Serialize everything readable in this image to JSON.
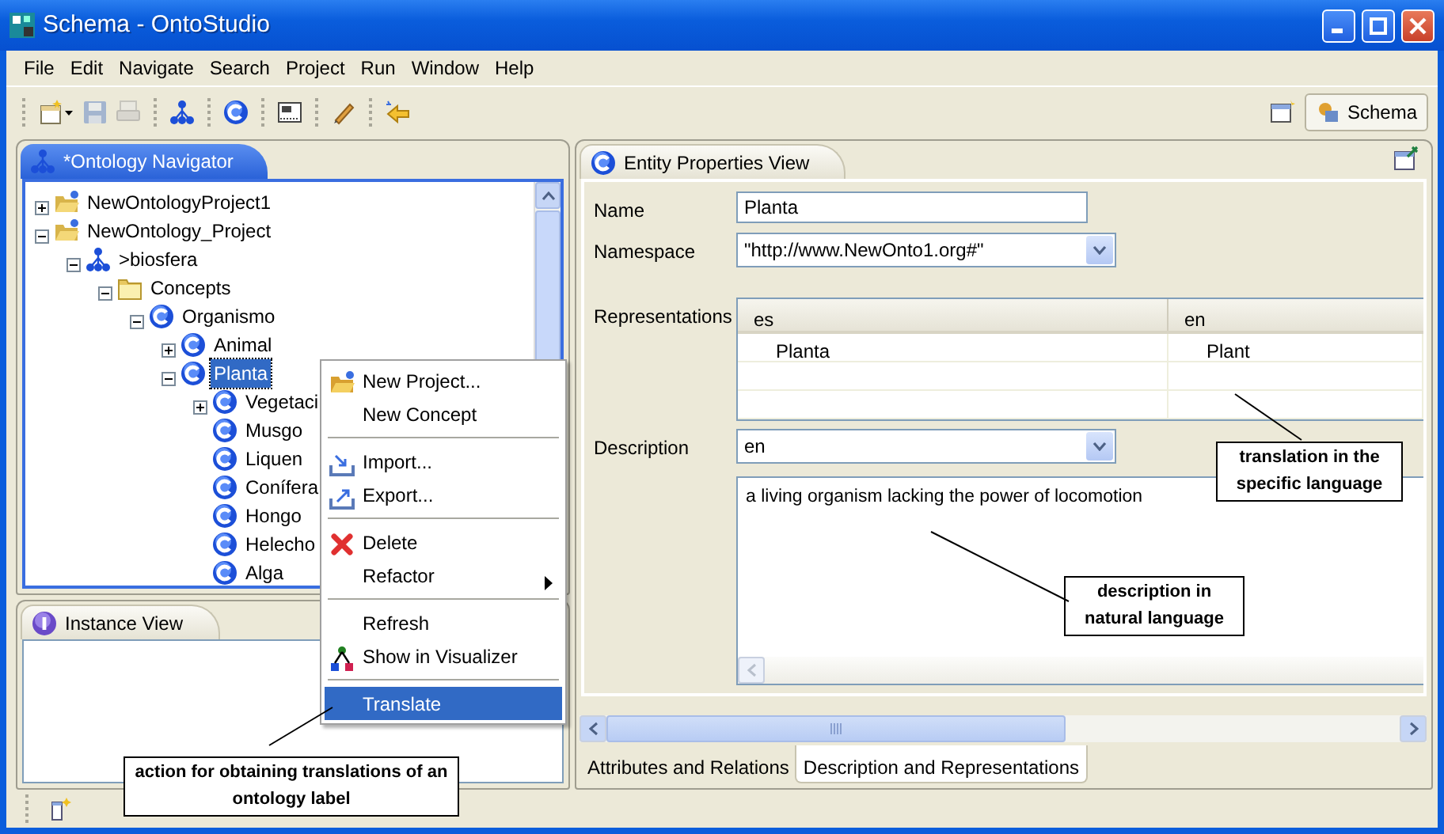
{
  "window": {
    "title": "Schema - OntoStudio"
  },
  "menu": [
    "File",
    "Edit",
    "Navigate",
    "Search",
    "Project",
    "Run",
    "Window",
    "Help"
  ],
  "toolbar": [
    {
      "kind": "new",
      "disabled": false
    },
    {
      "kind": "save",
      "disabled": true
    },
    {
      "kind": "print",
      "disabled": true
    },
    {
      "kind": "separator"
    },
    {
      "kind": "ontology",
      "disabled": false
    },
    {
      "kind": "separator"
    },
    {
      "kind": "concept",
      "disabled": false
    },
    {
      "kind": "separator"
    },
    {
      "kind": "document",
      "disabled": false
    },
    {
      "kind": "separator"
    },
    {
      "kind": "pen",
      "disabled": false
    },
    {
      "kind": "separator"
    },
    {
      "kind": "back",
      "disabled": false
    }
  ],
  "perspective": {
    "label": "Schema"
  },
  "navigator": {
    "title": "*Ontology Navigator",
    "active": true,
    "tree": [
      {
        "label": "NewOntologyProject1",
        "kind": "project",
        "expanded": false,
        "selected": false
      },
      {
        "label": "NewOntology_Project",
        "kind": "project",
        "expanded": true,
        "selected": false,
        "children": [
          {
            "label": ">biosfera",
            "kind": "ontology",
            "expanded": true,
            "selected": false,
            "children": [
              {
                "label": "Concepts",
                "kind": "folder",
                "expanded": true,
                "selected": false,
                "children": [
                  {
                    "label": "Organismo",
                    "kind": "concept",
                    "expanded": true,
                    "selected": false,
                    "children": [
                      {
                        "label": "Animal",
                        "kind": "concept",
                        "expanded": false,
                        "selected": false
                      },
                      {
                        "label": "Planta",
                        "kind": "concept",
                        "expanded": true,
                        "selected": true,
                        "children": [
                          {
                            "label": "Vegetaci",
                            "kind": "concept",
                            "expanded": false,
                            "selected": false
                          },
                          {
                            "label": "Musgo",
                            "kind": "concept",
                            "selected": false
                          },
                          {
                            "label": "Liquen",
                            "kind": "concept",
                            "selected": false
                          },
                          {
                            "label": "Conífera",
                            "kind": "concept",
                            "selected": false
                          },
                          {
                            "label": "Hongo",
                            "kind": "concept",
                            "selected": false
                          },
                          {
                            "label": "Helecho",
                            "kind": "concept",
                            "selected": false
                          },
                          {
                            "label": "Alga",
                            "kind": "concept",
                            "selected": false
                          }
                        ]
                      }
                    ]
                  }
                ]
              }
            ]
          }
        ]
      }
    ]
  },
  "context_menu": [
    {
      "kind": "new-project",
      "label": "New Project...",
      "selected": false
    },
    {
      "kind": "plain",
      "label": "New Concept",
      "selected": false
    },
    {
      "kind": "separator"
    },
    {
      "kind": "import",
      "label": "Import...",
      "selected": false
    },
    {
      "kind": "export",
      "label": "Export...",
      "selected": false
    },
    {
      "kind": "separator"
    },
    {
      "kind": "delete",
      "label": "Delete",
      "selected": false
    },
    {
      "kind": "submenu",
      "label": "Refactor",
      "selected": false
    },
    {
      "kind": "separator"
    },
    {
      "kind": "plain",
      "label": "Refresh",
      "selected": false
    },
    {
      "kind": "visualizer",
      "label": "Show in Visualizer",
      "selected": false
    },
    {
      "kind": "separator"
    },
    {
      "kind": "plain",
      "label": "Translate",
      "selected": true
    }
  ],
  "instance_view": {
    "title": "Instance View",
    "active": false
  },
  "entity_view": {
    "title": "Entity Properties View",
    "active": false,
    "name_label": "Name",
    "name_value": "Planta",
    "namespace_label": "Namespace",
    "namespace_value": "\"http://www.NewOnto1.org#\"",
    "representations_label": "Representations",
    "representations": {
      "columns": [
        "es",
        "en"
      ],
      "rows": [
        [
          "Planta",
          "Plant"
        ]
      ]
    },
    "description_label": "Description",
    "description_language": "en",
    "description_text": "a living organism lacking the power of locomotion",
    "tabs": [
      {
        "label": "Attributes and Relations",
        "selected": false
      },
      {
        "label": "Description and Representations",
        "selected": true
      }
    ]
  },
  "annotations": [
    {
      "text": "translation in the specific language"
    },
    {
      "text": "description in natural language"
    },
    {
      "text": "action for obtaining translations of an ontology label"
    }
  ]
}
